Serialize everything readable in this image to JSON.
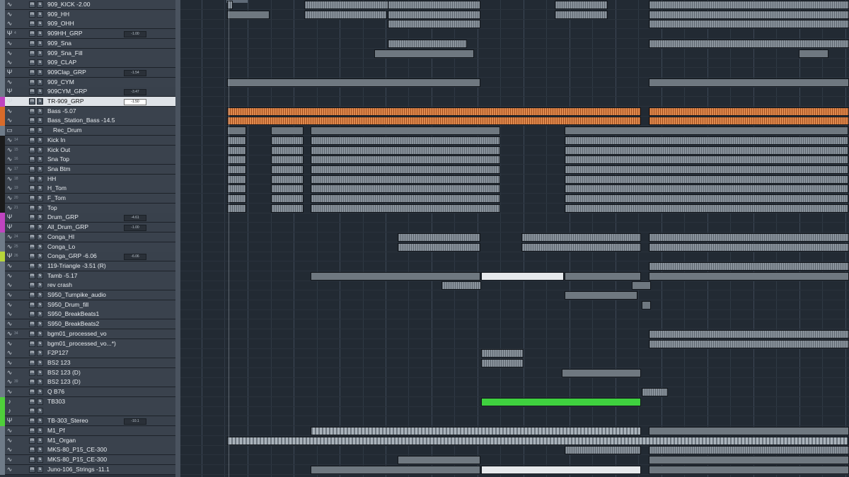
{
  "tracks": [
    {
      "num": "",
      "name": "909_KICK -2.00",
      "type": "audio",
      "color": "#6f7b88"
    },
    {
      "num": "",
      "name": "909_HH",
      "type": "audio",
      "color": "#6f7b88"
    },
    {
      "num": "",
      "name": "909_OHH",
      "type": "audio",
      "color": "#6f7b88"
    },
    {
      "num": "4",
      "name": "909HH_GRP",
      "type": "group",
      "vol": "-1.00",
      "color": "#6f7b88"
    },
    {
      "num": "",
      "name": "909_Sna",
      "type": "audio",
      "color": "#6f7b88"
    },
    {
      "num": "",
      "name": "909_Sna_Fill",
      "type": "audio",
      "color": "#6f7b88"
    },
    {
      "num": "",
      "name": "909_CLAP",
      "type": "audio",
      "color": "#6f7b88"
    },
    {
      "num": "",
      "name": "909Clap_GRP",
      "type": "group",
      "vol": "-1.54",
      "color": "#6f7b88"
    },
    {
      "num": "",
      "name": "909_CYM",
      "type": "audio",
      "color": "#6f7b88"
    },
    {
      "num": "",
      "name": "909CYM_GRP",
      "type": "group",
      "vol": "-3.47",
      "color": "#6f7b88"
    },
    {
      "num": "",
      "name": "TR-909_GRP",
      "type": "group",
      "vol": "-1.50",
      "color": "#c044c0",
      "selected": true
    },
    {
      "num": "",
      "name": "Bass -5.07",
      "type": "audio",
      "color": "#d86b2a"
    },
    {
      "num": "",
      "name": "Bass_Station_Bass -14.5",
      "type": "audio",
      "color": "#d86b2a"
    },
    {
      "num": "",
      "name": "Rec_Drum",
      "type": "folder",
      "color": "#6f7b88"
    },
    {
      "num": "14",
      "name": "Kick In",
      "type": "audio",
      "color": "#1a1a1a"
    },
    {
      "num": "15",
      "name": "Kick Out",
      "type": "audio",
      "color": "#1a1a1a"
    },
    {
      "num": "16",
      "name": "Sna Top",
      "type": "audio",
      "color": "#1a1a1a"
    },
    {
      "num": "17",
      "name": "Sna Btm",
      "type": "audio",
      "color": "#1a1a1a"
    },
    {
      "num": "18",
      "name": "HH",
      "type": "audio",
      "color": "#1a1a1a"
    },
    {
      "num": "19",
      "name": "H_Tom",
      "type": "audio",
      "color": "#1a1a1a"
    },
    {
      "num": "20",
      "name": "F_Tom",
      "type": "audio",
      "color": "#1a1a1a"
    },
    {
      "num": "21",
      "name": "Top",
      "type": "audio",
      "color": "#1a1a1a"
    },
    {
      "num": "",
      "name": "Drum_GRP",
      "type": "group",
      "vol": "-4.61",
      "color": "#c044c0"
    },
    {
      "num": "",
      "name": "All_Drum_GRP",
      "type": "group",
      "vol": "-1.00",
      "color": "#c044c0"
    },
    {
      "num": "24",
      "name": "Conga_HI",
      "type": "audio",
      "color": "#6f7b88"
    },
    {
      "num": "25",
      "name": "Conga_Lo",
      "type": "audio",
      "color": "#6f7b88"
    },
    {
      "num": "26",
      "name": "Conga_GRP -6.06",
      "type": "group",
      "vol": "-6.06",
      "color": "#b7d63a"
    },
    {
      "num": "",
      "name": "119-Triangle -3.51 (R)",
      "type": "audio",
      "color": "#6f7b88"
    },
    {
      "num": "",
      "name": "Tamb -5.17",
      "type": "audio",
      "color": "#6f7b88"
    },
    {
      "num": "",
      "name": "rev crash",
      "type": "audio",
      "color": "#6f7b88"
    },
    {
      "num": "",
      "name": "S950_Turnpike_audio",
      "type": "audio",
      "color": "#6f7b88"
    },
    {
      "num": "",
      "name": "S950_Drum_fill",
      "type": "audio",
      "color": "#6f7b88"
    },
    {
      "num": "",
      "name": "S950_BreakBeats1",
      "type": "audio",
      "color": "#6f7b88"
    },
    {
      "num": "",
      "name": "S950_BreakBeats2",
      "type": "audio",
      "color": "#6f7b88"
    },
    {
      "num": "34",
      "name": "bgm01_processed_vo",
      "type": "audio",
      "color": "#6f7b88"
    },
    {
      "num": "",
      "name": "bgm01_processed_vo...*)",
      "type": "audio",
      "color": "#6f7b88"
    },
    {
      "num": "",
      "name": "F2P127",
      "type": "audio",
      "color": "#6f7b88"
    },
    {
      "num": "",
      "name": "BS2 123",
      "type": "audio",
      "color": "#6f7b88"
    },
    {
      "num": "",
      "name": "BS2 123 (D)",
      "type": "audio",
      "color": "#6f7b88"
    },
    {
      "num": "39",
      "name": "BS2 123 (D)",
      "type": "audio",
      "color": "#6f7b88"
    },
    {
      "num": "",
      "name": "Q B76",
      "type": "audio",
      "color": "#6f7b88"
    },
    {
      "num": "",
      "name": "TB303",
      "type": "instrument",
      "color": "#4fcf3a"
    },
    {
      "num": "",
      "name": "",
      "type": "instrument",
      "color": "#4fcf3a"
    },
    {
      "num": "",
      "name": "TB-303_Stereo",
      "type": "group",
      "vol": "-10.1",
      "color": "#4fcf3a"
    },
    {
      "num": "",
      "name": "M1_Pf",
      "type": "audio",
      "color": "#6f7b88"
    },
    {
      "num": "",
      "name": "M1_Organ",
      "type": "audio",
      "color": "#6f7b88"
    },
    {
      "num": "",
      "name": "MKS-80_P15_CE-300",
      "type": "audio",
      "color": "#6f7b88"
    },
    {
      "num": "",
      "name": "MKS-80_P15_CE-300",
      "type": "audio",
      "color": "#6f7b88"
    },
    {
      "num": "",
      "name": "Juno-106_Strings -11.1",
      "type": "audio",
      "color": "#6f7b88"
    }
  ],
  "clips": [
    {
      "row": 0,
      "start": 0.07,
      "end": 0.08,
      "kind": "audio"
    },
    {
      "row": 0,
      "start": 0.185,
      "end": 0.32,
      "kind": "audio"
    },
    {
      "row": 0,
      "start": 0.31,
      "end": 0.45,
      "kind": "audio"
    },
    {
      "row": 0,
      "start": 0.56,
      "end": 0.64,
      "kind": "audio"
    },
    {
      "row": 0,
      "start": 0.7,
      "end": 1.0,
      "kind": "audio"
    },
    {
      "row": 1,
      "start": 0.07,
      "end": 0.135,
      "kind": "grey"
    },
    {
      "row": 1,
      "start": 0.185,
      "end": 0.31,
      "kind": "audio"
    },
    {
      "row": 1,
      "start": 0.31,
      "end": 0.45,
      "kind": "audio"
    },
    {
      "row": 1,
      "start": 0.56,
      "end": 0.64,
      "kind": "audio"
    },
    {
      "row": 1,
      "start": 0.7,
      "end": 1.0,
      "kind": "audio"
    },
    {
      "row": 2,
      "start": 0.31,
      "end": 0.45,
      "kind": "audio"
    },
    {
      "row": 2,
      "start": 0.7,
      "end": 1.0,
      "kind": "audio"
    },
    {
      "row": 4,
      "start": 0.31,
      "end": 0.43,
      "kind": "audio"
    },
    {
      "row": 4,
      "start": 0.7,
      "end": 1.0,
      "kind": "audio"
    },
    {
      "row": 5,
      "start": 0.29,
      "end": 0.44,
      "kind": "grey"
    },
    {
      "row": 5,
      "start": 0.925,
      "end": 0.97,
      "kind": "grey"
    },
    {
      "row": 8,
      "start": 0.07,
      "end": 0.45,
      "kind": "grey"
    },
    {
      "row": 8,
      "start": 0.7,
      "end": 1.0,
      "kind": "grey"
    },
    {
      "row": 11,
      "start": 0.07,
      "end": 0.69,
      "kind": "orange"
    },
    {
      "row": 11,
      "start": 0.7,
      "end": 1.0,
      "kind": "orange"
    },
    {
      "row": 12,
      "start": 0.07,
      "end": 0.69,
      "kind": "orange"
    },
    {
      "row": 12,
      "start": 0.7,
      "end": 1.0,
      "kind": "orange"
    },
    {
      "row": 13,
      "start": 0.07,
      "end": 0.1,
      "kind": "grey"
    },
    {
      "row": 13,
      "start": 0.135,
      "end": 0.185,
      "kind": "grey"
    },
    {
      "row": 13,
      "start": 0.195,
      "end": 0.48,
      "kind": "grey"
    },
    {
      "row": 13,
      "start": 0.575,
      "end": 1.0,
      "kind": "grey"
    },
    {
      "row": 14,
      "start": 0.07,
      "end": 0.1,
      "kind": "audio"
    },
    {
      "row": 14,
      "start": 0.135,
      "end": 0.185,
      "kind": "audio"
    },
    {
      "row": 14,
      "start": 0.195,
      "end": 0.48,
      "kind": "audio"
    },
    {
      "row": 14,
      "start": 0.575,
      "end": 1.0,
      "kind": "audio"
    },
    {
      "row": 15,
      "start": 0.07,
      "end": 0.1,
      "kind": "audio"
    },
    {
      "row": 15,
      "start": 0.135,
      "end": 0.185,
      "kind": "audio"
    },
    {
      "row": 15,
      "start": 0.195,
      "end": 0.48,
      "kind": "audio"
    },
    {
      "row": 15,
      "start": 0.575,
      "end": 1.0,
      "kind": "audio"
    },
    {
      "row": 16,
      "start": 0.07,
      "end": 0.1,
      "kind": "audio"
    },
    {
      "row": 16,
      "start": 0.135,
      "end": 0.185,
      "kind": "audio"
    },
    {
      "row": 16,
      "start": 0.195,
      "end": 0.48,
      "kind": "audio"
    },
    {
      "row": 16,
      "start": 0.575,
      "end": 1.0,
      "kind": "audio"
    },
    {
      "row": 17,
      "start": 0.07,
      "end": 0.1,
      "kind": "audio"
    },
    {
      "row": 17,
      "start": 0.135,
      "end": 0.185,
      "kind": "audio"
    },
    {
      "row": 17,
      "start": 0.195,
      "end": 0.48,
      "kind": "audio"
    },
    {
      "row": 17,
      "start": 0.575,
      "end": 1.0,
      "kind": "audio"
    },
    {
      "row": 18,
      "start": 0.07,
      "end": 0.1,
      "kind": "audio"
    },
    {
      "row": 18,
      "start": 0.135,
      "end": 0.185,
      "kind": "audio"
    },
    {
      "row": 18,
      "start": 0.195,
      "end": 0.48,
      "kind": "audio"
    },
    {
      "row": 18,
      "start": 0.575,
      "end": 1.0,
      "kind": "audio"
    },
    {
      "row": 19,
      "start": 0.07,
      "end": 0.1,
      "kind": "audio"
    },
    {
      "row": 19,
      "start": 0.135,
      "end": 0.185,
      "kind": "audio"
    },
    {
      "row": 19,
      "start": 0.195,
      "end": 0.48,
      "kind": "audio"
    },
    {
      "row": 19,
      "start": 0.575,
      "end": 1.0,
      "kind": "audio"
    },
    {
      "row": 20,
      "start": 0.07,
      "end": 0.1,
      "kind": "audio"
    },
    {
      "row": 20,
      "start": 0.135,
      "end": 0.185,
      "kind": "audio"
    },
    {
      "row": 20,
      "start": 0.195,
      "end": 0.48,
      "kind": "audio"
    },
    {
      "row": 20,
      "start": 0.575,
      "end": 1.0,
      "kind": "audio"
    },
    {
      "row": 21,
      "start": 0.07,
      "end": 0.1,
      "kind": "audio"
    },
    {
      "row": 21,
      "start": 0.135,
      "end": 0.185,
      "kind": "audio"
    },
    {
      "row": 21,
      "start": 0.195,
      "end": 0.48,
      "kind": "audio"
    },
    {
      "row": 21,
      "start": 0.575,
      "end": 1.0,
      "kind": "audio"
    },
    {
      "row": 24,
      "start": 0.325,
      "end": 0.45,
      "kind": "audio"
    },
    {
      "row": 24,
      "start": 0.51,
      "end": 0.69,
      "kind": "audio"
    },
    {
      "row": 24,
      "start": 0.7,
      "end": 1.0,
      "kind": "audio"
    },
    {
      "row": 25,
      "start": 0.325,
      "end": 0.45,
      "kind": "audio"
    },
    {
      "row": 25,
      "start": 0.51,
      "end": 0.69,
      "kind": "audio"
    },
    {
      "row": 25,
      "start": 0.7,
      "end": 1.0,
      "kind": "audio"
    },
    {
      "row": 27,
      "start": 0.7,
      "end": 1.0,
      "kind": "audio"
    },
    {
      "row": 28,
      "start": 0.195,
      "end": 0.45,
      "kind": "grey"
    },
    {
      "row": 28,
      "start": 0.45,
      "end": 0.575,
      "kind": "white"
    },
    {
      "row": 28,
      "start": 0.575,
      "end": 0.69,
      "kind": "grey"
    },
    {
      "row": 28,
      "start": 0.7,
      "end": 1.0,
      "kind": "grey"
    },
    {
      "row": 29,
      "start": 0.39,
      "end": 0.45,
      "kind": "audio"
    },
    {
      "row": 29,
      "start": 0.675,
      "end": 0.705,
      "kind": "grey"
    },
    {
      "row": 30,
      "start": 0.575,
      "end": 0.685,
      "kind": "grey"
    },
    {
      "row": 31,
      "start": 0.69,
      "end": 0.705,
      "kind": "grey"
    },
    {
      "row": 34,
      "start": 0.7,
      "end": 1.0,
      "kind": "audio"
    },
    {
      "row": 35,
      "start": 0.7,
      "end": 1.0,
      "kind": "audio"
    },
    {
      "row": 36,
      "start": 0.45,
      "end": 0.515,
      "kind": "audio"
    },
    {
      "row": 37,
      "start": 0.45,
      "end": 0.515,
      "kind": "audio"
    },
    {
      "row": 38,
      "start": 0.57,
      "end": 0.69,
      "kind": "grey"
    },
    {
      "row": 40,
      "start": 0.69,
      "end": 0.73,
      "kind": "audio"
    },
    {
      "row": 41,
      "start": 0.45,
      "end": 0.69,
      "kind": "green"
    },
    {
      "row": 44,
      "start": 0.195,
      "end": 0.69,
      "kind": "midi"
    },
    {
      "row": 44,
      "start": 0.7,
      "end": 1.0,
      "kind": "grey"
    },
    {
      "row": 45,
      "start": 0.07,
      "end": 1.0,
      "kind": "midi"
    },
    {
      "row": 46,
      "start": 0.575,
      "end": 0.69,
      "kind": "audio"
    },
    {
      "row": 46,
      "start": 0.7,
      "end": 1.0,
      "kind": "audio"
    },
    {
      "row": 47,
      "start": 0.325,
      "end": 0.45,
      "kind": "grey"
    },
    {
      "row": 47,
      "start": 0.7,
      "end": 1.0,
      "kind": "grey"
    },
    {
      "row": 48,
      "start": 0.195,
      "end": 0.45,
      "kind": "grey"
    },
    {
      "row": 48,
      "start": 0.45,
      "end": 0.69,
      "kind": "white"
    },
    {
      "row": 48,
      "start": 0.7,
      "end": 1.0,
      "kind": "grey"
    }
  ]
}
